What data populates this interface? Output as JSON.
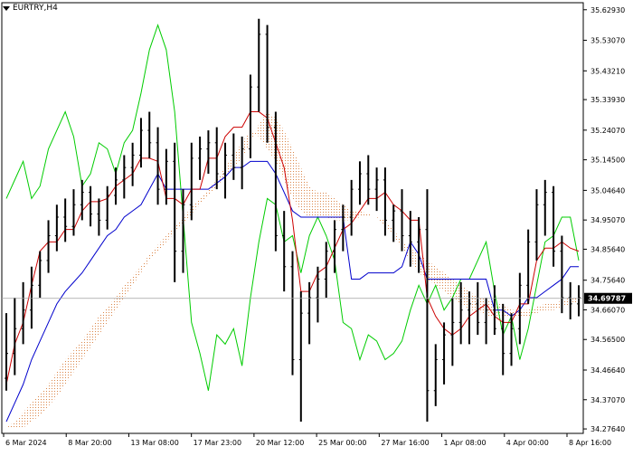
{
  "symbol_label": "EURTRY,H4",
  "colors": {
    "tenkan": "#cc0000",
    "kijun": "#0000cc",
    "chikou": "#00cc00",
    "cloud": "#d2691e",
    "bars": "#000000",
    "last_price_bg": "#000000",
    "last_price_fg": "#ffffff"
  },
  "chart_data": {
    "type": "ohlc",
    "indicator": "ichimoku",
    "y_ticks": [
      "35.62930",
      "35.53070",
      "35.43210",
      "35.33930",
      "35.24070",
      "35.14500",
      "35.04640",
      "34.95070",
      "34.85640",
      "34.75640",
      "34.66070",
      "34.56500",
      "34.46640",
      "34.37070",
      "34.27640"
    ],
    "x_ticks": [
      "6 Mar 2024",
      "8 Mar 20:00",
      "13 Mar 08:00",
      "17 Mar 23:00",
      "20 Mar 12:00",
      "25 Mar 00:00",
      "27 Mar 16:00",
      "1 Apr 08:00",
      "4 Apr 00:00",
      "8 Apr 16:00"
    ],
    "ylim": [
      34.262,
      35.652
    ],
    "last_price": "34.69787",
    "last_price_value": 34.69787,
    "grid": false,
    "bars": [
      [
        34.44,
        34.65,
        34.4,
        34.52
      ],
      [
        34.52,
        34.7,
        34.45,
        34.6
      ],
      [
        34.6,
        34.75,
        34.55,
        34.66
      ],
      [
        34.66,
        34.8,
        34.6,
        34.74
      ],
      [
        34.74,
        34.85,
        34.7,
        34.82
      ],
      [
        34.82,
        34.95,
        34.78,
        34.9
      ],
      [
        34.9,
        35.0,
        34.85,
        34.96
      ],
      [
        34.96,
        35.02,
        34.88,
        34.93
      ],
      [
        34.93,
        35.05,
        34.9,
        35.0
      ],
      [
        35.0,
        35.08,
        34.95,
        35.04
      ],
      [
        35.04,
        35.06,
        34.93,
        34.97
      ],
      [
        34.97,
        35.02,
        34.9,
        34.95
      ],
      [
        34.95,
        35.06,
        34.92,
        35.03
      ],
      [
        35.03,
        35.12,
        35.0,
        35.08
      ],
      [
        35.08,
        35.16,
        35.02,
        35.12
      ],
      [
        35.12,
        35.2,
        35.06,
        35.16
      ],
      [
        35.16,
        35.28,
        35.12,
        35.24
      ],
      [
        35.24,
        35.3,
        35.15,
        35.2
      ],
      [
        35.2,
        35.25,
        35.0,
        35.05
      ],
      [
        35.05,
        35.18,
        35.0,
        35.14
      ],
      [
        35.14,
        35.2,
        34.75,
        34.85
      ],
      [
        34.85,
        35.05,
        34.78,
        35.0
      ],
      [
        35.0,
        35.2,
        34.95,
        35.15
      ],
      [
        35.15,
        35.22,
        35.08,
        35.18
      ],
      [
        35.18,
        35.24,
        35.1,
        35.2
      ],
      [
        35.2,
        35.25,
        35.05,
        35.1
      ],
      [
        35.1,
        35.2,
        35.02,
        35.16
      ],
      [
        35.16,
        35.23,
        35.08,
        35.12
      ],
      [
        35.12,
        35.22,
        35.05,
        35.18
      ],
      [
        35.18,
        35.42,
        35.15,
        35.38
      ],
      [
        35.38,
        35.6,
        35.3,
        35.55
      ],
      [
        35.55,
        35.58,
        35.2,
        35.25
      ],
      [
        35.25,
        35.3,
        34.85,
        34.9
      ],
      [
        34.9,
        34.98,
        34.72,
        34.8
      ],
      [
        34.8,
        34.85,
        34.45,
        34.5
      ],
      [
        34.5,
        34.72,
        34.3,
        34.65
      ],
      [
        34.65,
        34.75,
        34.55,
        34.7
      ],
      [
        34.7,
        34.8,
        34.62,
        34.76
      ],
      [
        34.76,
        34.88,
        34.7,
        34.85
      ],
      [
        34.85,
        34.95,
        34.78,
        34.92
      ],
      [
        34.92,
        35.0,
        34.85,
        34.96
      ],
      [
        34.96,
        35.08,
        34.9,
        35.05
      ],
      [
        35.05,
        35.14,
        35.0,
        35.1
      ],
      [
        35.1,
        35.16,
        35.0,
        35.05
      ],
      [
        35.05,
        35.12,
        34.98,
        35.08
      ],
      [
        35.08,
        35.12,
        34.9,
        34.95
      ],
      [
        34.95,
        35.0,
        34.88,
        34.98
      ],
      [
        34.98,
        35.05,
        34.85,
        34.9
      ],
      [
        34.9,
        34.98,
        34.8,
        34.88
      ],
      [
        34.88,
        34.96,
        34.78,
        34.92
      ],
      [
        34.92,
        35.05,
        34.3,
        34.4
      ],
      [
        34.4,
        34.55,
        34.35,
        34.5
      ],
      [
        34.5,
        34.62,
        34.42,
        34.58
      ],
      [
        34.58,
        34.7,
        34.48,
        34.62
      ],
      [
        34.62,
        34.75,
        34.55,
        34.66
      ],
      [
        34.66,
        34.72,
        34.55,
        34.68
      ],
      [
        34.68,
        34.75,
        34.58,
        34.62
      ],
      [
        34.62,
        34.7,
        34.55,
        34.66
      ],
      [
        34.66,
        34.74,
        34.58,
        34.6
      ],
      [
        34.6,
        34.68,
        34.45,
        34.52
      ],
      [
        34.52,
        34.65,
        34.48,
        34.6
      ],
      [
        34.6,
        34.78,
        34.55,
        34.74
      ],
      [
        34.74,
        34.92,
        34.68,
        34.88
      ],
      [
        34.88,
        35.05,
        34.82,
        35.0
      ],
      [
        35.0,
        35.08,
        34.9,
        35.04
      ],
      [
        35.04,
        35.06,
        34.8,
        34.85
      ],
      [
        34.85,
        34.9,
        34.65,
        34.7
      ],
      [
        34.7,
        34.75,
        34.63,
        34.68
      ],
      [
        34.68,
        34.74,
        34.64,
        34.7
      ]
    ],
    "series": [
      {
        "name": "",
        "role": "tenkan-sen",
        "values": [
          34.42,
          34.55,
          34.62,
          34.74,
          34.85,
          34.88,
          34.88,
          34.92,
          34.92,
          34.98,
          35.01,
          35.01,
          35.02,
          35.06,
          35.08,
          35.1,
          35.15,
          35.15,
          35.14,
          35.02,
          35.02,
          35.0,
          35.05,
          35.05,
          35.15,
          35.15,
          35.22,
          35.25,
          35.25,
          35.3,
          35.3,
          35.28,
          35.2,
          35.12,
          34.95,
          34.72,
          34.72,
          34.78,
          34.8,
          34.86,
          34.92,
          34.94,
          34.98,
          35.02,
          35.02,
          35.04,
          35.0,
          34.98,
          34.95,
          34.95,
          34.7,
          34.64,
          34.6,
          34.58,
          34.6,
          34.64,
          34.66,
          34.68,
          34.64,
          34.62,
          34.62,
          34.68,
          34.68,
          34.82,
          34.86,
          34.86,
          34.88,
          34.86,
          34.85
        ]
      },
      {
        "name": "",
        "role": "kijun-sen",
        "values": [
          34.3,
          34.36,
          34.42,
          34.5,
          34.56,
          34.62,
          34.68,
          34.72,
          34.75,
          34.78,
          34.82,
          34.86,
          34.9,
          34.92,
          34.96,
          34.98,
          35.0,
          35.05,
          35.1,
          35.05,
          35.05,
          35.05,
          35.05,
          35.05,
          35.05,
          35.07,
          35.09,
          35.12,
          35.12,
          35.14,
          35.14,
          35.14,
          35.1,
          35.04,
          34.98,
          34.96,
          34.96,
          34.96,
          34.96,
          34.96,
          34.96,
          34.76,
          34.76,
          34.78,
          34.78,
          34.78,
          34.78,
          34.8,
          34.88,
          34.84,
          34.76,
          34.76,
          34.76,
          34.76,
          34.76,
          34.76,
          34.76,
          34.76,
          34.66,
          34.66,
          34.64,
          34.66,
          34.7,
          34.7,
          34.72,
          34.74,
          34.76,
          34.8,
          34.8
        ]
      },
      {
        "name": "",
        "role": "chikou-span",
        "values": [
          35.02,
          35.08,
          35.14,
          35.02,
          35.06,
          35.18,
          35.24,
          35.3,
          35.22,
          35.06,
          35.1,
          35.2,
          35.18,
          35.1,
          35.2,
          35.24,
          35.36,
          35.5,
          35.58,
          35.5,
          35.3,
          34.96,
          34.62,
          34.52,
          34.4,
          34.58,
          34.55,
          34.6,
          34.48,
          34.7,
          34.88,
          35.02,
          35.0,
          34.88,
          34.9,
          34.78,
          34.9,
          34.96,
          34.9,
          34.82,
          34.62,
          34.6,
          34.5,
          34.58,
          34.56,
          34.5,
          34.52,
          34.56,
          34.66,
          34.74,
          34.68,
          34.74,
          34.66,
          34.7,
          34.76,
          34.76,
          34.82,
          34.88,
          34.72,
          34.58,
          34.64,
          34.5,
          34.6,
          34.74,
          34.88,
          34.9,
          34.96,
          34.96,
          34.82
        ]
      },
      {
        "name": "",
        "role": "senkou-span-a",
        "values": [
          34.28,
          34.3,
          34.33,
          34.36,
          34.39,
          34.42,
          34.46,
          34.5,
          34.53,
          34.56,
          34.6,
          34.64,
          34.67,
          34.7,
          34.74,
          34.77,
          34.8,
          34.84,
          34.87,
          34.9,
          34.93,
          34.96,
          34.99,
          35.02,
          35.05,
          35.08,
          35.12,
          35.16,
          35.2,
          35.24,
          35.22,
          35.18,
          35.14,
          35.08,
          35.02,
          34.98,
          34.96,
          34.96,
          34.96,
          34.95,
          34.95,
          34.95,
          34.96,
          34.96,
          34.96,
          34.95,
          34.92,
          34.88,
          34.86,
          34.84,
          34.82,
          34.8,
          34.78,
          34.76,
          34.74,
          34.72,
          34.7,
          34.7,
          34.68,
          34.68,
          34.66,
          34.66,
          34.66,
          34.67,
          34.68,
          34.68,
          34.69,
          34.7,
          34.7
        ]
      },
      {
        "name": "",
        "role": "senkou-span-b",
        "values": [
          34.28,
          34.28,
          34.28,
          34.3,
          34.32,
          34.35,
          34.38,
          34.42,
          34.46,
          34.5,
          34.54,
          34.58,
          34.62,
          34.66,
          34.7,
          34.74,
          34.78,
          34.82,
          34.85,
          34.88,
          34.91,
          34.94,
          34.97,
          35.0,
          35.03,
          35.06,
          35.09,
          35.12,
          35.15,
          35.2,
          35.26,
          35.3,
          35.28,
          35.24,
          35.18,
          35.12,
          35.06,
          35.04,
          35.04,
          35.02,
          35.0,
          34.98,
          34.98,
          34.97,
          34.96,
          34.93,
          34.9,
          34.86,
          34.82,
          34.78,
          34.76,
          34.74,
          34.72,
          34.7,
          34.68,
          34.66,
          34.66,
          34.64,
          34.64,
          34.64,
          34.64,
          34.64,
          34.64,
          34.65,
          34.66,
          34.66,
          34.67,
          34.68,
          34.68
        ]
      }
    ]
  }
}
